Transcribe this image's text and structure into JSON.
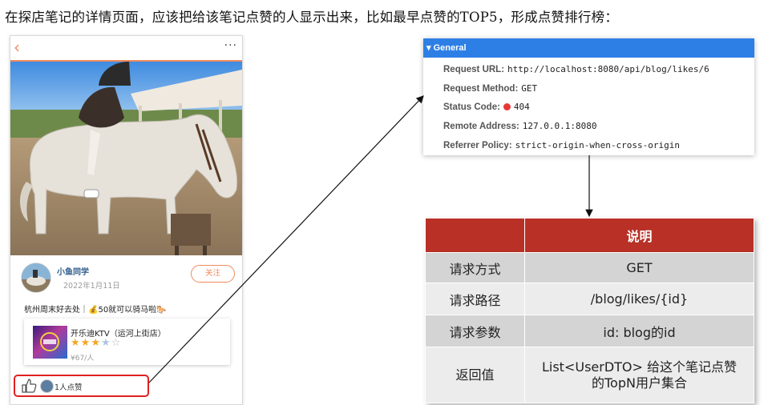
{
  "headline": "在探店笔记的详情页面，应该把给该笔记点赞的人显示出来，比如最早点赞的TOP5，形成点赞排行榜：",
  "phone": {
    "back_icon": "‹",
    "more_icon": "···",
    "author": {
      "name": "小鱼同学",
      "date": "2022年1月11日",
      "follow_label": "关注"
    },
    "note_text": "杭州周末好去处｜💰50就可以骑马啦🐎",
    "shop": {
      "name": "开乐迪KTV（运河上街店）",
      "rating": 3.5,
      "price": "¥67/人"
    },
    "likes": {
      "count_text": "1人点赞"
    }
  },
  "devtools": {
    "section_title": "▾ General",
    "rows": [
      {
        "label": "Request URL:",
        "value": "http://localhost:8080/api/blog/likes/6"
      },
      {
        "label": "Request Method:",
        "value": "GET"
      },
      {
        "label": "Status Code:",
        "value": "404",
        "status_color": "#e53935"
      },
      {
        "label": "Remote Address:",
        "value": "127.0.0.1:8080"
      },
      {
        "label": "Referrer Policy:",
        "value": "strict-origin-when-cross-origin"
      }
    ]
  },
  "table": {
    "header": [
      "",
      "说明"
    ],
    "rows": [
      {
        "label": "请求方式",
        "value": "GET"
      },
      {
        "label": "请求路径",
        "value": "/blog/likes/{id}"
      },
      {
        "label": "请求参数",
        "value": "id: blog的id"
      },
      {
        "label": "返回值",
        "value_line1": "List<UserDTO> 给这个笔记点赞",
        "value_line2": "的TopN用户集合"
      }
    ]
  },
  "colors": {
    "accent_orange": "#f08a5d",
    "devtools_blue": "#2d7fe6",
    "table_header_red": "#b83026",
    "highlight_red": "#e02020"
  }
}
